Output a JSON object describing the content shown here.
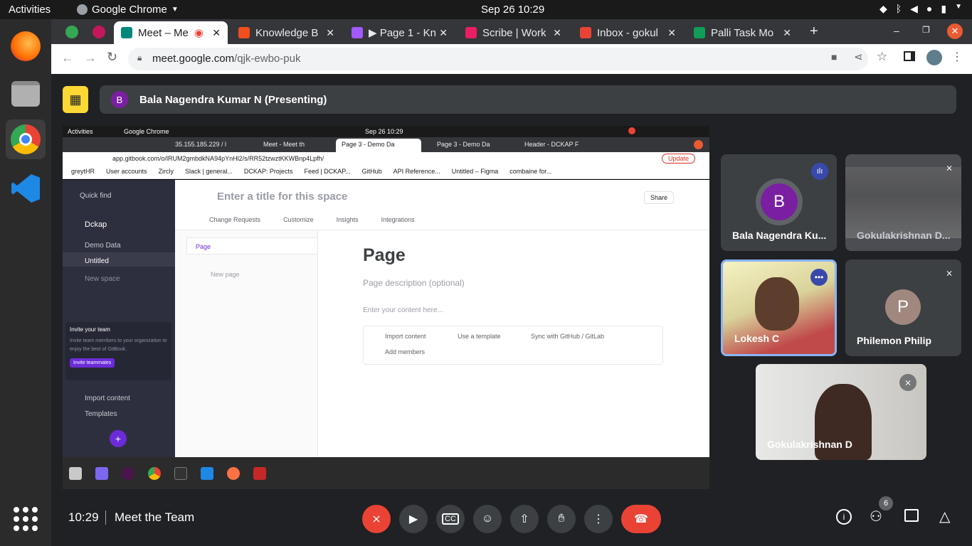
{
  "os": {
    "activities": "Activities",
    "app_menu": "Google Chrome",
    "clock": "Sep 26  10:29"
  },
  "browser": {
    "tabs": [
      {
        "label": "Meet – Me",
        "color": "#00897b"
      },
      {
        "label": "Knowledge B",
        "color": "#f24e1e"
      },
      {
        "label": "▶ Page 1 - Kn",
        "color": "#a259ff"
      },
      {
        "label": "Scribe | Work",
        "color": "#e91e63"
      },
      {
        "label": "Inbox - gokul",
        "color": "#ea4335"
      },
      {
        "label": "Palli Task Mo",
        "color": "#0f9d58"
      }
    ],
    "url_domain": "meet.google.com",
    "url_path": "/qjk-ewbo-puk"
  },
  "meet": {
    "presenter": "Bala Nagendra Kumar N (Presenting)",
    "presenter_initial": "B",
    "time": "10:29",
    "meeting_title": "Meet the Team",
    "participant_count": "6",
    "participants": [
      {
        "name": "Bala Nagendra Ku...",
        "initial": "B",
        "avatar_color": "#7b1fa2"
      },
      {
        "name": "Gokulakrishnan D...",
        "initial": ""
      },
      {
        "name": "Lokesh C",
        "initial": ""
      },
      {
        "name": "Philemon Philip",
        "initial": "P",
        "avatar_color": "#a1887f"
      },
      {
        "name": "Gokulakrishnan D",
        "initial": ""
      }
    ]
  },
  "shared": {
    "os": {
      "activities": "Activities",
      "app": "Google Chrome",
      "clock": "Sep 26  10:29"
    },
    "tabs": [
      "35.155.185.229 / l",
      "Meet - Meet th",
      "Page 3 - Demo Da",
      "Page 3 - Demo Da",
      "Header - DCKAP F"
    ],
    "url": "app.gitbook.com/o/lRUM2gmbdkNA94pYnHl2/s/RR52tzwztKKWBnp4Lpfh/",
    "update_label": "Update",
    "bookmarks": [
      "greytHR",
      "User accounts",
      "Zircly",
      "Slack | general...",
      "DCKAP: Projects",
      "Feed | DCKAP...",
      "GitHub",
      "API Reference...",
      "Untitled – Figma",
      "combaine for..."
    ],
    "sidebar": {
      "quick_find": "Quick find",
      "org": "Dckap",
      "items": [
        "Demo Data",
        "Untitled",
        "New space"
      ],
      "invite_title": "Invite your team",
      "invite_text": "Invite team members to your organization to enjoy the best of GitBook.",
      "invite_button": "Invite teammates",
      "import": "Import content",
      "templates": "Templates"
    },
    "space_title": "Enter a title for this space",
    "share": "Share",
    "toolbar": [
      "Change Requests",
      "Customize",
      "Insights",
      "Integrations"
    ],
    "nav": {
      "page": "Page",
      "new_page": "New page"
    },
    "page": {
      "title": "Page",
      "description": "Page description (optional)",
      "content": "Enter your content here...",
      "actions": [
        "Import content",
        "Use a template",
        "Sync with GitHub / GitLab",
        "Add members"
      ]
    }
  }
}
